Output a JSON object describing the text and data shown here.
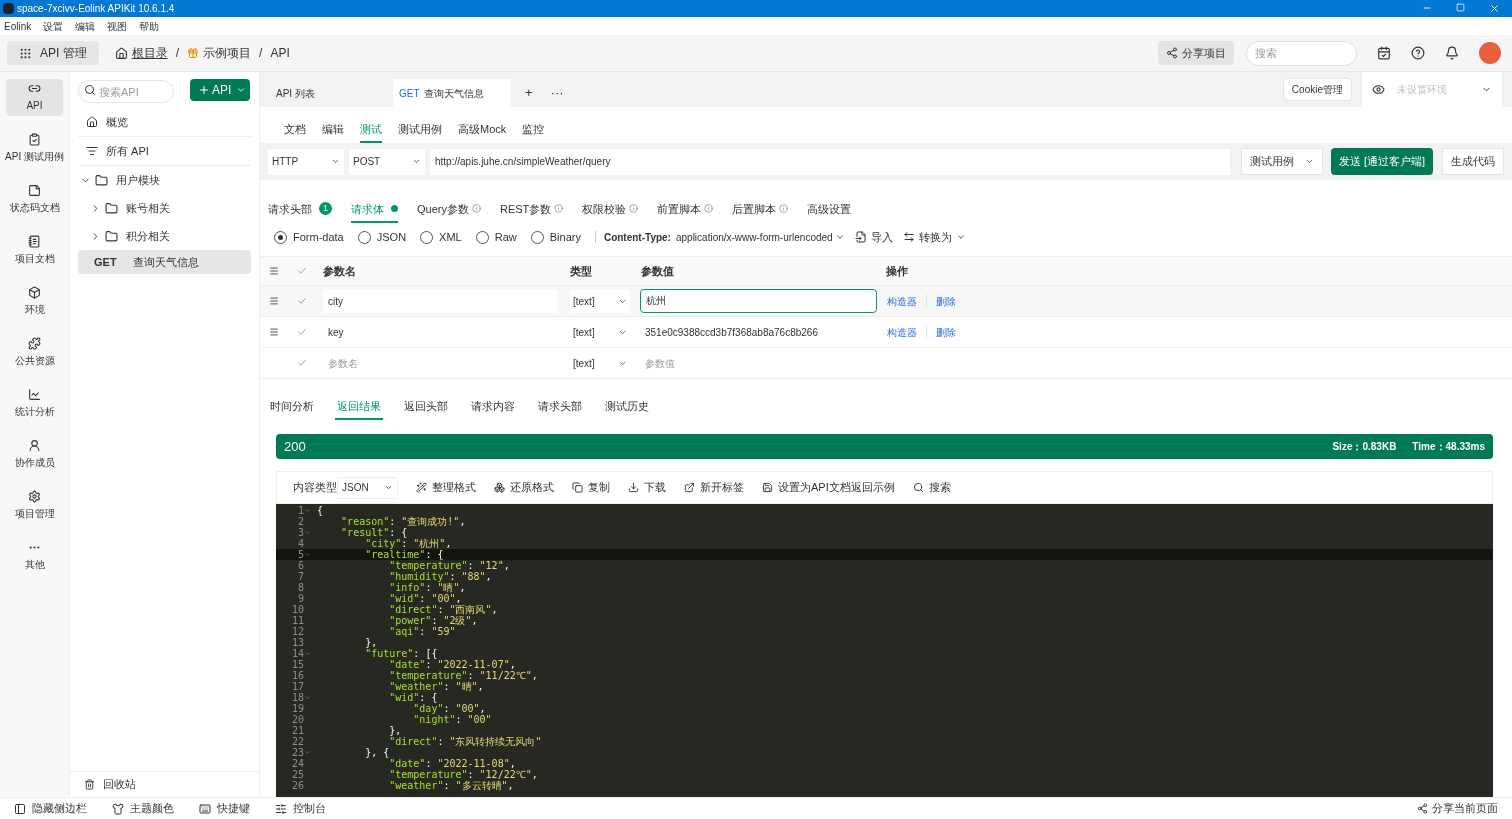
{
  "window": {
    "title": "space-7xcivv-Eolink APIKit 10.6.1.4"
  },
  "menu": [
    "Eolink",
    "设置",
    "编辑",
    "视图",
    "帮助"
  ],
  "topbar": {
    "module_button": "API 管理",
    "breadcrumb": [
      {
        "kind": "link",
        "text": "根目录"
      },
      {
        "kind": "separator",
        "text": "/"
      },
      {
        "kind": "project",
        "text": "示例项目"
      },
      {
        "kind": "separator",
        "text": "/"
      },
      {
        "kind": "text",
        "text": "API"
      }
    ],
    "share_button": "分享项目",
    "search": {
      "placeholder": "搜索"
    }
  },
  "rail": [
    {
      "label": "API",
      "selected": true
    },
    {
      "label": "API 测试用例",
      "selected": false
    },
    {
      "label": "状态码文档",
      "selected": false
    },
    {
      "label": "项目文档",
      "selected": false
    },
    {
      "label": "环境",
      "selected": false
    },
    {
      "label": "公共资源",
      "selected": false
    },
    {
      "label": "统计分析",
      "selected": false
    },
    {
      "label": "协作成员",
      "selected": false
    },
    {
      "label": "项目管理",
      "selected": false
    },
    {
      "label": "其他",
      "selected": false
    }
  ],
  "sidebar": {
    "search": {
      "placeholder": "搜索API"
    },
    "add_button": "API",
    "items": [
      {
        "kind": "home",
        "label": "概览",
        "selected": false
      },
      {
        "kind": "list",
        "label": "所有 API",
        "selected": false
      },
      {
        "kind": "folder",
        "label": "用户模块",
        "expanded": true,
        "selected": false,
        "children": [
          {
            "kind": "folder",
            "label": "账号相关",
            "expanded": false,
            "selected": false
          },
          {
            "kind": "folder",
            "label": "积分相关",
            "expanded": false,
            "selected": false
          }
        ]
      },
      {
        "kind": "api",
        "method": "GET",
        "label": "查询天气信息",
        "selected": true
      }
    ],
    "trash": "回收站"
  },
  "doc_tabs": [
    {
      "label": "API 列表",
      "selected": false
    },
    {
      "method": "GET",
      "label": "查询天气信息",
      "selected": true
    }
  ],
  "tab_actions": [
    "+",
    "···"
  ],
  "cookie_button": "Cookie管理",
  "environment": {
    "placeholder": "未设置环境"
  },
  "sub_tabs": [
    {
      "label": "文档",
      "selected": false
    },
    {
      "label": "编辑",
      "selected": false
    },
    {
      "label": "测试",
      "selected": true
    },
    {
      "label": "测试用例",
      "selected": false
    },
    {
      "label": "高级Mock",
      "selected": false
    },
    {
      "label": "监控",
      "selected": false
    }
  ],
  "request": {
    "protocol": "HTTP",
    "method": "POST",
    "url": "http://apis.juhe.cn/simpleWeather/query",
    "case_button": "测试用例",
    "send_button": "发送 [通过客户端]",
    "code_button": "生成代码"
  },
  "body_tabs": [
    {
      "label": "请求头部",
      "badge": "1",
      "dot": false,
      "info": false,
      "selected": false
    },
    {
      "label": "请求体",
      "dot": true,
      "info": false,
      "selected": true
    },
    {
      "label": "Query参数",
      "dot": false,
      "info": true,
      "selected": false
    },
    {
      "label": "REST参数",
      "dot": false,
      "info": true,
      "selected": false
    },
    {
      "label": "权限校验",
      "dot": false,
      "info": true,
      "selected": false
    },
    {
      "label": "前置脚本",
      "dot": false,
      "info": true,
      "selected": false
    },
    {
      "label": "后置脚本",
      "dot": false,
      "info": true,
      "selected": false
    },
    {
      "label": "高级设置",
      "dot": false,
      "info": false,
      "selected": false
    }
  ],
  "body_formats": [
    {
      "label": "Form-data",
      "selected": true
    },
    {
      "label": "JSON",
      "selected": false
    },
    {
      "label": "XML",
      "selected": false
    },
    {
      "label": "Raw",
      "selected": false
    },
    {
      "label": "Binary",
      "selected": false
    }
  ],
  "content_type": {
    "label": "Content-Type:",
    "value": "application/x-www-form-urlencoded"
  },
  "import_button": "导入",
  "convert_button": "转换为",
  "params": {
    "columns": [
      "参数名",
      "类型",
      "参数值",
      "操作"
    ],
    "rows": [
      {
        "name": "city",
        "type": "[text]",
        "value": "杭州",
        "checked": true,
        "focused": true,
        "actions": [
          "构造器",
          "删除"
        ]
      },
      {
        "name": "key",
        "type": "[text]",
        "value": "351e0c9388ccd3b7f368ab8a76c8b266",
        "checked": true,
        "focused": false,
        "actions": [
          "构造器",
          "删除"
        ]
      },
      {
        "name_placeholder": "参数名",
        "type": "[text]",
        "value_placeholder": "参数值",
        "checked": true,
        "focused": false
      }
    ]
  },
  "result_tabs": [
    {
      "label": "时间分析",
      "selected": false
    },
    {
      "label": "返回结果",
      "selected": true
    },
    {
      "label": "返回头部",
      "selected": false
    },
    {
      "label": "请求内容",
      "selected": false
    },
    {
      "label": "请求头部",
      "selected": false
    },
    {
      "label": "测试历史",
      "selected": false
    }
  ],
  "status": {
    "code": "200",
    "size": "Size：0.83KB",
    "time": "Time：48.33ms"
  },
  "result_toolbar": {
    "content_type_label": "内容类型",
    "content_type": "JSON",
    "actions": [
      "整理格式",
      "还原格式",
      "复制",
      "下载",
      "新开标签",
      "设置为API文档返回示例",
      "搜索"
    ]
  },
  "code": [
    {
      "number": "1",
      "text": "{",
      "foldable": true,
      "active": false
    },
    {
      "number": "2",
      "text": "    \"reason\": \"查询成功!\",",
      "foldable": false,
      "active": false
    },
    {
      "number": "3",
      "text": "    \"result\": {",
      "foldable": true,
      "active": false
    },
    {
      "number": "4",
      "text": "        \"city\": \"杭州\",",
      "foldable": false,
      "active": false
    },
    {
      "number": "5",
      "text": "        \"realtime\": {",
      "foldable": true,
      "active": true
    },
    {
      "number": "6",
      "text": "            \"temperature\": \"12\",",
      "foldable": false,
      "active": false
    },
    {
      "number": "7",
      "text": "            \"humidity\": \"88\",",
      "foldable": false,
      "active": false
    },
    {
      "number": "8",
      "text": "            \"info\": \"晴\",",
      "foldable": false,
      "active": false
    },
    {
      "number": "9",
      "text": "            \"wid\": \"00\",",
      "foldable": false,
      "active": false
    },
    {
      "number": "10",
      "text": "            \"direct\": \"西南风\",",
      "foldable": false,
      "active": false
    },
    {
      "number": "11",
      "text": "            \"power\": \"2级\",",
      "foldable": false,
      "active": false
    },
    {
      "number": "12",
      "text": "            \"aqi\": \"59\"",
      "foldable": false,
      "active": false
    },
    {
      "number": "13",
      "text": "        },",
      "foldable": false,
      "active": false
    },
    {
      "number": "14",
      "text": "        \"future\": [{",
      "foldable": true,
      "active": false
    },
    {
      "number": "15",
      "text": "            \"date\": \"2022-11-07\",",
      "foldable": false,
      "active": false
    },
    {
      "number": "16",
      "text": "            \"temperature\": \"11/22℃\",",
      "foldable": false,
      "active": false
    },
    {
      "number": "17",
      "text": "            \"weather\": \"晴\",",
      "foldable": false,
      "active": false
    },
    {
      "number": "18",
      "text": "            \"wid\": {",
      "foldable": true,
      "active": false
    },
    {
      "number": "19",
      "text": "                \"day\": \"00\",",
      "foldable": false,
      "active": false
    },
    {
      "number": "20",
      "text": "                \"night\": \"00\"",
      "foldable": false,
      "active": false
    },
    {
      "number": "21",
      "text": "            },",
      "foldable": false,
      "active": false
    },
    {
      "number": "22",
      "text": "            \"direct\": \"东风转持续无风向\"",
      "foldable": false,
      "active": false
    },
    {
      "number": "23",
      "text": "        }, {",
      "foldable": true,
      "active": false
    },
    {
      "number": "24",
      "text": "            \"date\": \"2022-11-08\",",
      "foldable": false,
      "active": false
    },
    {
      "number": "25",
      "text": "            \"temperature\": \"12/22℃\",",
      "foldable": false,
      "active": false
    },
    {
      "number": "26",
      "text": "            \"weather\": \"多云转晴\",",
      "foldable": false,
      "active": false
    }
  ],
  "bottom_bar": {
    "items": [
      "隐藏侧边栏",
      "主题颜色",
      "快捷键",
      "控制台"
    ],
    "share": "分享当前页面"
  }
}
